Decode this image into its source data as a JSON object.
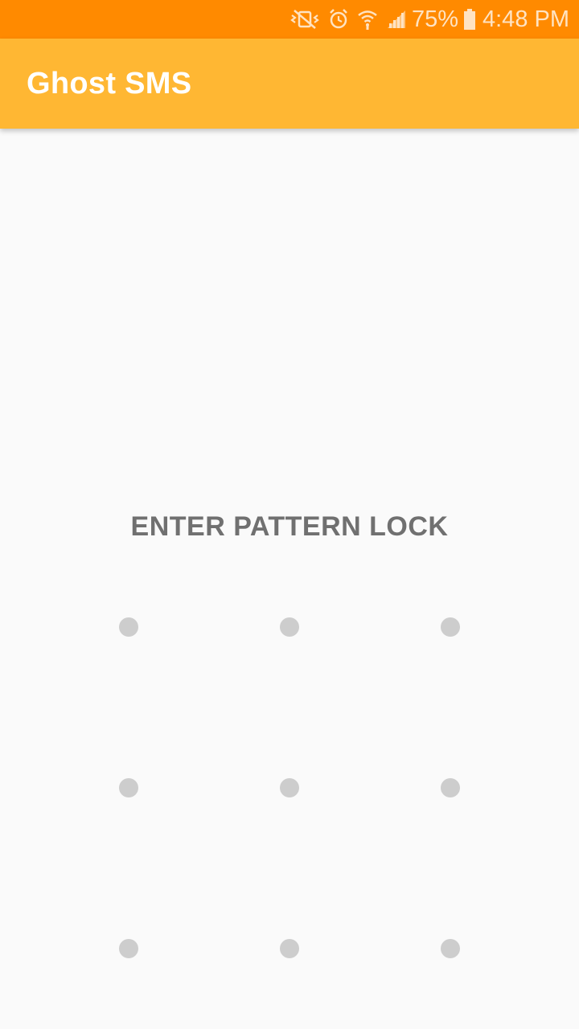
{
  "status_bar": {
    "icons": [
      "vibrate-off-icon",
      "alarm-icon",
      "wifi-icon",
      "signal-icon"
    ],
    "battery_percent": "75%",
    "battery_icon": "battery-icon",
    "time": "4:48 PM"
  },
  "app_bar": {
    "title": "Ghost SMS"
  },
  "pattern_lock": {
    "title": "ENTER PATTERN LOCK",
    "dots": [
      {
        "id": 1
      },
      {
        "id": 2
      },
      {
        "id": 3
      },
      {
        "id": 4
      },
      {
        "id": 5
      },
      {
        "id": 6
      },
      {
        "id": 7
      },
      {
        "id": 8
      },
      {
        "id": 9
      }
    ],
    "dot_color": "#cdcdcd"
  },
  "colors": {
    "status_bar": "#ff8a00",
    "app_bar": "#ffb733",
    "background": "#fafafa"
  }
}
